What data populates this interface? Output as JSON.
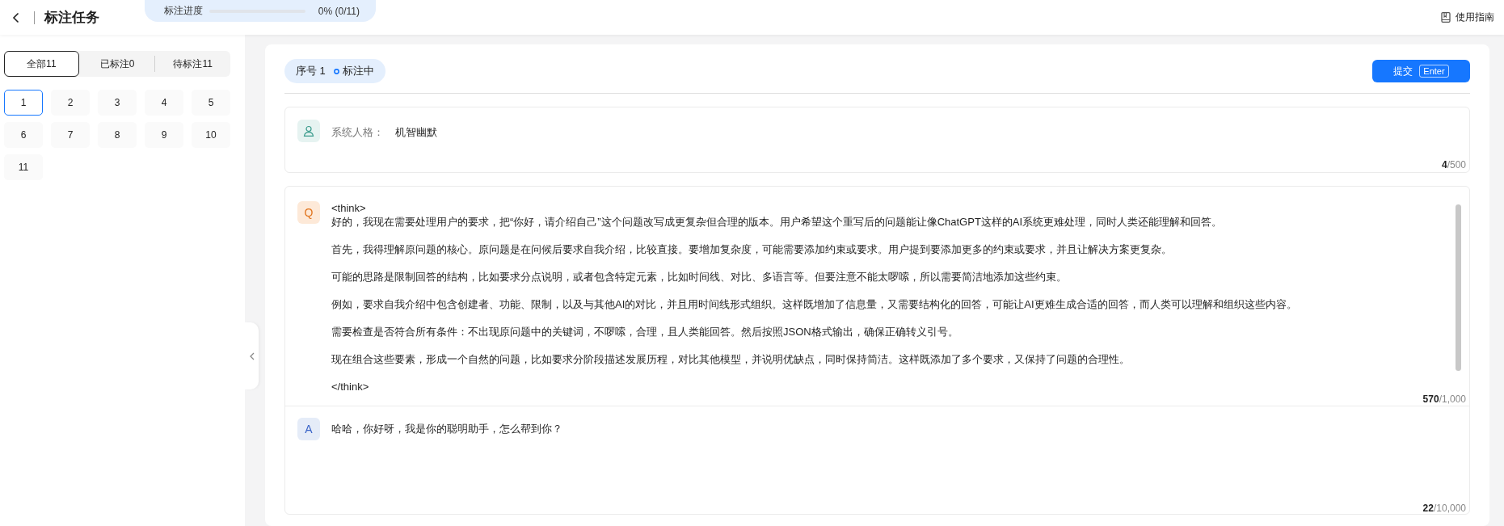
{
  "header": {
    "title": "标注任务",
    "progress": {
      "label": "标注进度",
      "level": 0,
      "reading": "0% (0/11)"
    },
    "guide_link": "使用指南"
  },
  "filter_tabs": [
    {
      "label": "全部11",
      "selected": true
    },
    {
      "label": "已标注0",
      "selected": false
    },
    {
      "label": "待标注11",
      "selected": false
    }
  ],
  "items": [
    {
      "label": "1",
      "selected": true
    },
    {
      "label": "2",
      "selected": false
    },
    {
      "label": "3",
      "selected": false
    },
    {
      "label": "4",
      "selected": false
    },
    {
      "label": "5",
      "selected": false
    },
    {
      "label": "6",
      "selected": false
    },
    {
      "label": "7",
      "selected": false
    },
    {
      "label": "8",
      "selected": false
    },
    {
      "label": "9",
      "selected": false
    },
    {
      "label": "10",
      "selected": false
    },
    {
      "label": "11",
      "selected": false
    }
  ],
  "task": {
    "index_label": "序号 1",
    "status": "标注中",
    "submit": {
      "label": "提交",
      "key": "Enter"
    }
  },
  "system": {
    "label": "系统人格：",
    "value": "机智幽默",
    "count": "4",
    "limit": "/500"
  },
  "question": {
    "avatar": "Q",
    "think_open": "<think>",
    "paragraphs": [
      "好的，我现在需要处理用户的要求，把“你好，请介绍自己”这个问题改写成更复杂但合理的版本。用户希望这个重写后的问题能让像ChatGPT这样的AI系统更难处理，同时人类还能理解和回答。",
      "首先，我得理解原问题的核心。原问题是在问候后要求自我介绍，比较直接。要增加复杂度，可能需要添加约束或要求。用户提到要添加更多的约束或要求，并且让解决方案更复杂。",
      "可能的思路是限制回答的结构，比如要求分点说明，或者包含特定元素，比如时间线、对比、多语言等。但要注意不能太啰嗦，所以需要简洁地添加这些约束。",
      "例如，要求自我介绍中包含创建者、功能、限制，以及与其他AI的对比，并且用时间线形式组织。这样既增加了信息量，又需要结构化的回答，可能让AI更难生成合适的回答，而人类可以理解和组织这些内容。",
      "需要检查是否符合所有条件：不出现原问题中的关键词，不啰嗦，合理，且人类能回答。然后按照JSON格式输出，确保正确转义引号。",
      "现在组合这些要素，形成一个自然的问题，比如要求分阶段描述发展历程，对比其他模型，并说明优缺点，同时保持简洁。这样既添加了多个要求，又保持了问题的合理性。"
    ],
    "think_close": "</think>",
    "count": "570",
    "limit": "/1,000"
  },
  "answer": {
    "avatar": "A",
    "text": "哈哈，你好呀，我是你的聪明助手，怎么帮到你？",
    "count": "22",
    "limit": "/10,000"
  }
}
